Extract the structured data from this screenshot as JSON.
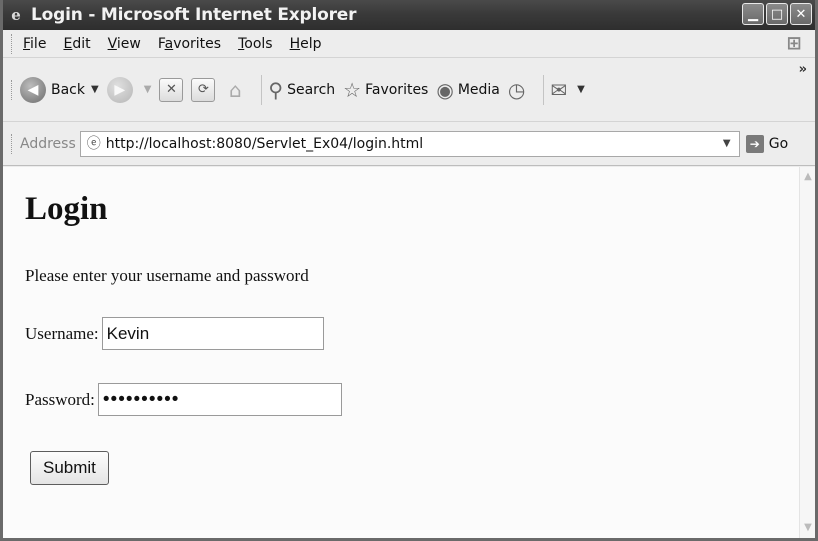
{
  "window": {
    "title": "Login - Microsoft Internet Explorer",
    "app_icon": "ie-icon",
    "buttons": {
      "minimize": "_",
      "maximize": "□",
      "close": "✕"
    }
  },
  "menu": {
    "items": [
      {
        "label": "File",
        "key": "F",
        "rest": "ile"
      },
      {
        "label": "Edit",
        "key": "E",
        "rest": "dit"
      },
      {
        "label": "View",
        "key": "V",
        "rest": "iew"
      },
      {
        "label": "Favorites",
        "key": "a",
        "pre": "F",
        "rest": "vorites"
      },
      {
        "label": "Tools",
        "key": "T",
        "rest": "ools"
      },
      {
        "label": "Help",
        "key": "H",
        "rest": "elp"
      }
    ]
  },
  "toolbar": {
    "back_label": "Back",
    "search_label": "Search",
    "favorites_label": "Favorites",
    "media_label": "Media",
    "more": "»"
  },
  "address": {
    "label": "Address",
    "url": "http://localhost:8080/Servlet_Ex04/login.html",
    "go_label": "Go"
  },
  "page": {
    "heading": "Login",
    "instructions": "Please enter your username and password",
    "username_label": "Username:",
    "username_value": "Kevin",
    "password_label": "Password:",
    "password_value": "••••••••••",
    "submit_label": "Submit"
  }
}
